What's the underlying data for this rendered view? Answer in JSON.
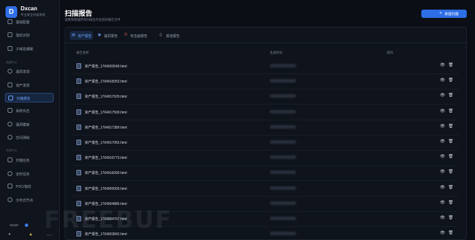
{
  "brand": {
    "logo_letter": "D",
    "name": "Dxcan",
    "subtitle": "专业安全扫描系统"
  },
  "sidebar": {
    "items_top": [
      {
        "label": "基础配置",
        "icon": "settings-icon"
      },
      {
        "label": "指纹识别",
        "icon": "fingerprint-icon"
      },
      {
        "label": "子域名爆破",
        "icon": "domain-icon"
      }
    ],
    "section_results": "结果中心",
    "items_results": [
      {
        "label": "漏洞发现",
        "icon": "shield-icon",
        "active": false
      },
      {
        "label": "资产发现",
        "icon": "asset-icon",
        "active": false
      },
      {
        "label": "扫描报告",
        "icon": "report-icon",
        "active": true
      },
      {
        "label": "系统日志",
        "icon": "log-icon",
        "active": false
      },
      {
        "label": "漏洞模板",
        "icon": "template-icon",
        "active": false
      },
      {
        "label": "空间测绘",
        "icon": "globe-icon",
        "active": false
      }
    ],
    "section_tasks": "任务中心",
    "items_tasks": [
      {
        "label": "扫描任务",
        "icon": "task-icon"
      },
      {
        "label": "定时任务",
        "icon": "clock-icon"
      },
      {
        "label": "POC/指纹",
        "icon": "poc-icon"
      },
      {
        "label": "分布式节点",
        "icon": "node-icon"
      }
    ],
    "footer": {
      "text": "WEBP",
      "version": "v1.0"
    }
  },
  "header": {
    "title": "扫描报告",
    "subtitle": "查看和管理所有扫描任务生成的报告文件",
    "new_button_label": "新建扫描"
  },
  "tabs": [
    {
      "label": "资产报告",
      "icon": "document-icon",
      "active": true
    },
    {
      "label": "漏洞报告",
      "icon": "shield-icon",
      "active": false
    },
    {
      "label": "攻击面报告",
      "icon": "target-icon",
      "active": false
    },
    {
      "label": "其他报告",
      "icon": "file-icon",
      "active": false
    }
  ],
  "table": {
    "columns": [
      "报告名称",
      "生成时间",
      "操作"
    ],
    "rows": [
      {
        "name": "资产报告_1764920549.html"
      },
      {
        "name": "资产报告_1764918253.html"
      },
      {
        "name": "资产报告_1764917629.html"
      },
      {
        "name": "资产报告_1764917509.html"
      },
      {
        "name": "资产报告_1764917389.html"
      },
      {
        "name": "资产报告_1764917055.html"
      },
      {
        "name": "资产报告_1764916773.html"
      },
      {
        "name": "资产报告_1764916090.html"
      },
      {
        "name": "资产报告_1764905009.html"
      },
      {
        "name": "资产报告_1764904885.html"
      },
      {
        "name": "资产报告_1764904767.html"
      },
      {
        "name": "资产报告_1764903842.html"
      }
    ]
  },
  "watermark": "FREEBUF",
  "colors": {
    "accent": "#2e6ee6",
    "active_text": "#6ea4ff",
    "background": "#0b0e14"
  }
}
